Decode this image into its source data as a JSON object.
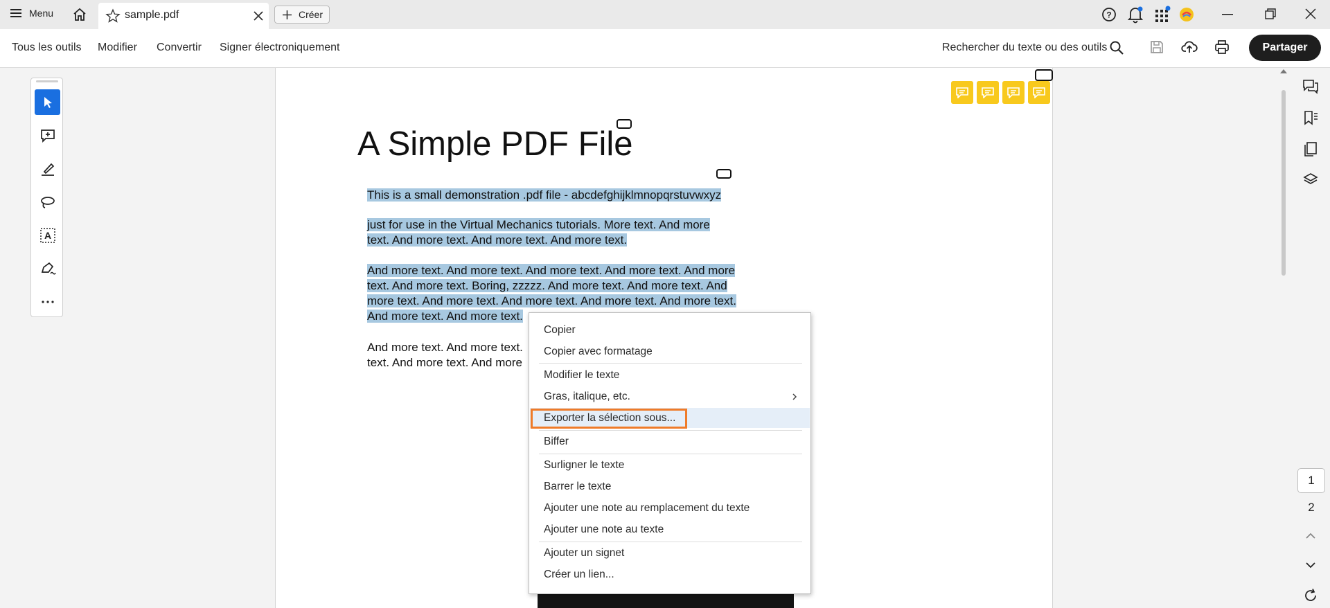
{
  "titlebar": {
    "menu_label": "Menu",
    "tab_title": "sample.pdf",
    "create_label": "Créer"
  },
  "toolbar": {
    "all_tools": "Tous les outils",
    "modify": "Modifier",
    "convert": "Convertir",
    "sign": "Signer électroniquement",
    "search_label": "Rechercher du texte ou des outils",
    "share": "Partager"
  },
  "document": {
    "title": "A Simple PDF File",
    "line1_a": "This is a small demonstration .pdf file - ",
    "line1_b": "abcdefghijklmnopqrstuvwxyz",
    "para2": [
      "just for use in the Virtual Mechanics tutorials. More text. And more",
      "text. And more text. And more text. And more text."
    ],
    "para3": [
      "And more text. And more text. And more text. And more text. And more",
      "text. And more text. Boring, zzzzz. And more text. And more text. And",
      "more text. And more text. And more text. And more text. And more text.",
      "And more text. And more text."
    ],
    "para4": [
      "And more text. And more text.",
      "text. And more text. And more"
    ]
  },
  "context_menu": {
    "copy": "Copier",
    "copy_format": "Copier avec formatage",
    "edit_text": "Modifier le texte",
    "bold_italic": "Gras, italique, etc.",
    "export_selection": "Exporter la sélection sous...",
    "strike": "Biffer",
    "highlight": "Surligner le texte",
    "strikethrough": "Barrer le texte",
    "replace_note": "Ajouter une note au remplacement du texte",
    "text_note": "Ajouter une note au texte",
    "bookmark": "Ajouter un signet",
    "link": "Créer un lien..."
  },
  "pages": {
    "current": "1",
    "next": "2"
  },
  "colors": {
    "accent_blue": "#1a6fe0",
    "selection": "#a7c8e0",
    "note_yellow": "#f8c91d",
    "export_outline": "#ef7b29"
  }
}
